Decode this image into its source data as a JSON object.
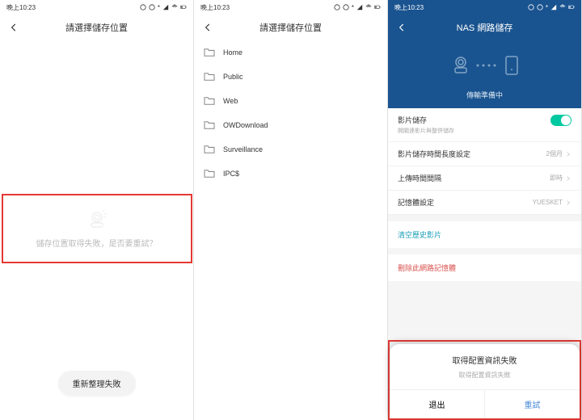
{
  "status": {
    "time": "晚上10:23",
    "icons": "∦ ◢ ☎ ▢"
  },
  "screen1": {
    "title": "請選擇儲存位置",
    "fail_text": "儲存位置取得失敗，是否要重試？",
    "refresh_fail": "重新整理失敗"
  },
  "screen2": {
    "title": "請選擇儲存位置",
    "folders": [
      "Home",
      "Public",
      "Web",
      "OWDownload",
      "Surveillance",
      "IPC$"
    ]
  },
  "screen3": {
    "title": "NAS 網路儲存",
    "transfer": "傳輸準備中",
    "rows": {
      "storage_title": "影片儲存",
      "storage_sub": "開關連影片與整併儲存",
      "duration_title": "影片儲存時間長度設定",
      "duration_val": "2個月",
      "upload_title": "上傳時間間隔",
      "upload_val": "即時",
      "device_title": "記憶體設定",
      "device_val": "YUESKET"
    },
    "clear_history": "清空歷史影片",
    "delete_storage": "刪除此網路記憶體",
    "sheet_title": "取得配置資訊失敗",
    "sheet_sub": "取得配置資訊失敗",
    "sheet_exit": "退出",
    "sheet_retry": "重試"
  }
}
